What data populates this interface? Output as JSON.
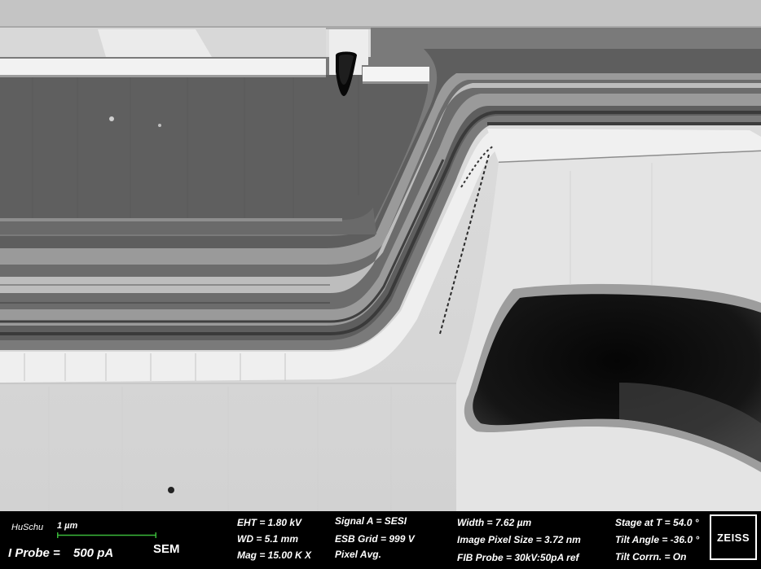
{
  "image": {
    "description_icon": "sem-cross-section-micrograph"
  },
  "info_bar": {
    "operator": "HuSchu",
    "scale_label": "1 µm",
    "scale_color": "#3ab83a",
    "probe_current": "I Probe =",
    "probe_value": "500 pA",
    "mode": "SEM",
    "eht": "EHT =  1.80 kV",
    "wd": "WD =  5.1 mm",
    "mag": "Mag =   15.00 K X",
    "signal_a": "Signal A = SESI",
    "esb_grid": "ESB Grid =   999 V",
    "pixel_avg": "Pixel Avg.",
    "width": "Width = 7.62 µm",
    "pixel_size": "Image Pixel Size = 3.72 nm",
    "fib_probe": "FIB Probe = 30kV:50pA ref",
    "stage_t": "Stage at T =  54.0 °",
    "tilt_angle": "Tilt Angle = -36.0 °",
    "tilt_corrn": "Tilt Corrn. = On",
    "logo": "ZEISS"
  }
}
